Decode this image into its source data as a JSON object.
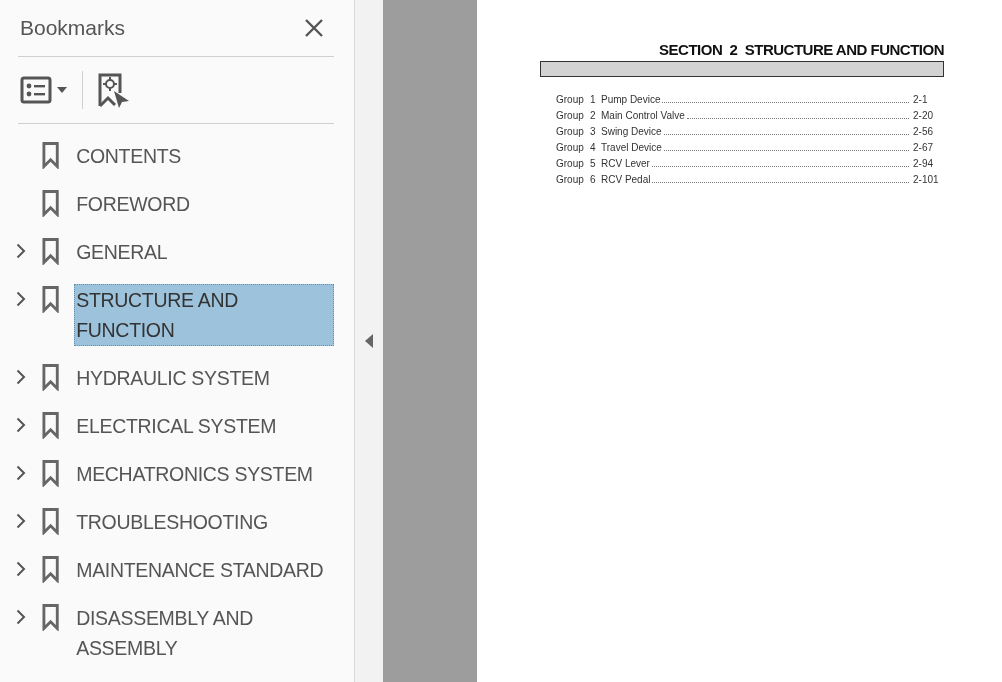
{
  "sidebar": {
    "title": "Bookmarks",
    "items": [
      {
        "label": "CONTENTS",
        "expandable": false,
        "selected": false
      },
      {
        "label": "FOREWORD",
        "expandable": false,
        "selected": false
      },
      {
        "label": "GENERAL",
        "expandable": true,
        "selected": false
      },
      {
        "label": "STRUCTURE AND FUNCTION",
        "expandable": true,
        "selected": true
      },
      {
        "label": "HYDRAULIC SYSTEM",
        "expandable": true,
        "selected": false
      },
      {
        "label": "ELECTRICAL SYSTEM",
        "expandable": true,
        "selected": false
      },
      {
        "label": "MECHATRONICS SYSTEM",
        "expandable": true,
        "selected": false
      },
      {
        "label": "TROUBLESHOOTING",
        "expandable": true,
        "selected": false
      },
      {
        "label": "MAINTENANCE STANDARD",
        "expandable": true,
        "selected": false
      },
      {
        "label": "DISASSEMBLY AND ASSEMBLY",
        "expandable": true,
        "selected": false
      }
    ]
  },
  "document": {
    "heading": "SECTION  2  STRUCTURE AND FUNCTION",
    "toc": [
      {
        "group": "Group",
        "number": "1",
        "title": "Pump Device",
        "page": "2-1"
      },
      {
        "group": "Group",
        "number": "2",
        "title": "Main Control Valve",
        "page": "2-20"
      },
      {
        "group": "Group",
        "number": "3",
        "title": "Swing Device",
        "page": "2-56"
      },
      {
        "group": "Group",
        "number": "4",
        "title": "Travel Device",
        "page": "2-67"
      },
      {
        "group": "Group",
        "number": "5",
        "title": "RCV Lever",
        "page": "2-94"
      },
      {
        "group": "Group",
        "number": "6",
        "title": "RCV Pedal",
        "page": "2-101"
      }
    ]
  }
}
